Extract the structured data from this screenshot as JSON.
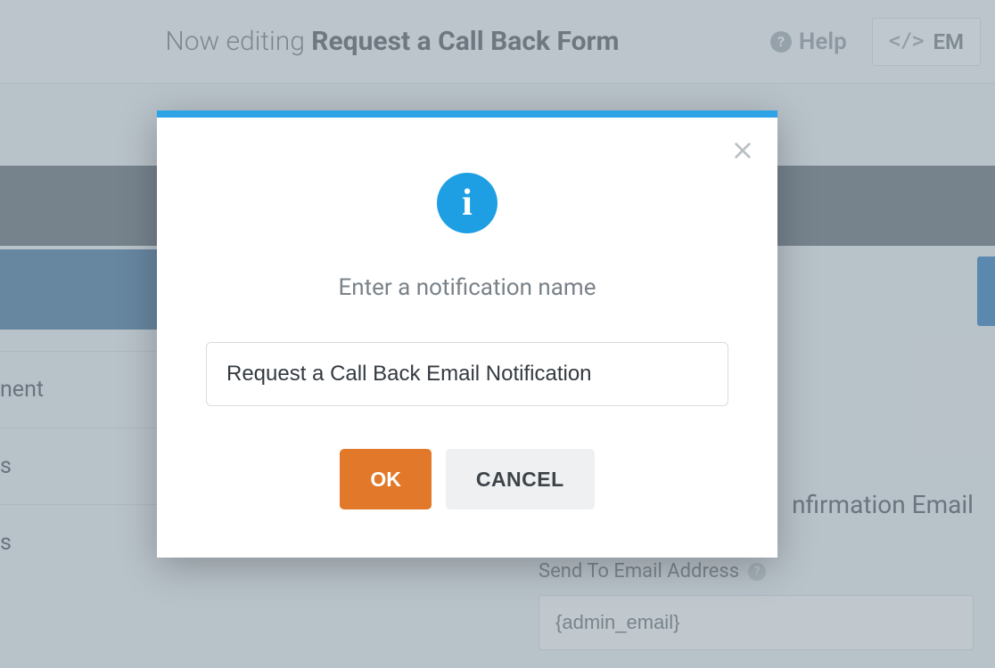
{
  "header": {
    "editing_prefix": "Now editing",
    "form_name": "Request a Call Back Form",
    "help_label": "Help",
    "embed_label": "EM"
  },
  "sidebar": {
    "items": [
      {
        "label_fragment": "nent"
      },
      {
        "label_fragment": "s"
      },
      {
        "label_fragment": "s",
        "has_chevron": true
      }
    ]
  },
  "right_panel": {
    "title_fragment": "nfirmation Email",
    "field": {
      "label": "Send To Email Address",
      "value": "{admin_email}"
    }
  },
  "modal": {
    "prompt": "Enter a notification name",
    "input_value": "Request a Call Back Email Notification",
    "ok_label": "OK",
    "cancel_label": "CANCEL"
  }
}
